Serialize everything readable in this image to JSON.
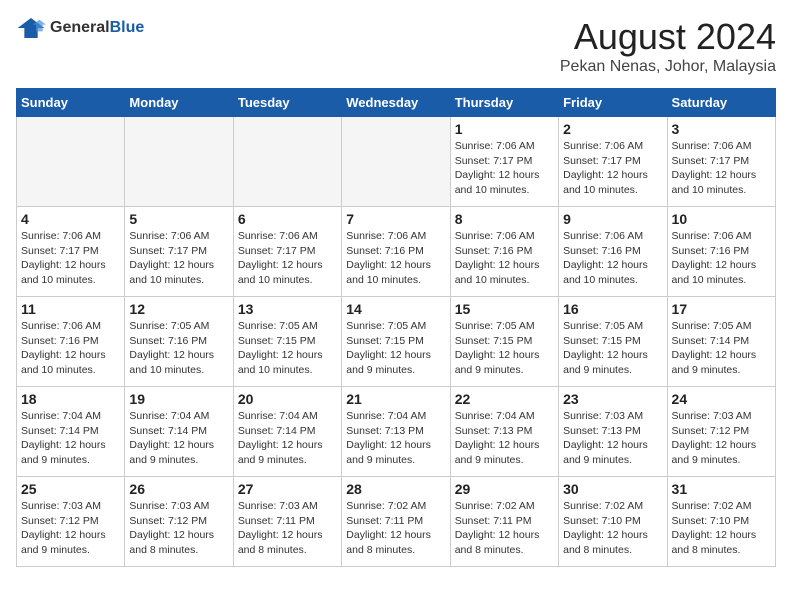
{
  "logo": {
    "general": "General",
    "blue": "Blue"
  },
  "title": "August 2024",
  "subtitle": "Pekan Nenas, Johor, Malaysia",
  "headers": [
    "Sunday",
    "Monday",
    "Tuesday",
    "Wednesday",
    "Thursday",
    "Friday",
    "Saturday"
  ],
  "weeks": [
    [
      {
        "day": "",
        "info": ""
      },
      {
        "day": "",
        "info": ""
      },
      {
        "day": "",
        "info": ""
      },
      {
        "day": "",
        "info": ""
      },
      {
        "day": "1",
        "info": "Sunrise: 7:06 AM\nSunset: 7:17 PM\nDaylight: 12 hours\nand 10 minutes."
      },
      {
        "day": "2",
        "info": "Sunrise: 7:06 AM\nSunset: 7:17 PM\nDaylight: 12 hours\nand 10 minutes."
      },
      {
        "day": "3",
        "info": "Sunrise: 7:06 AM\nSunset: 7:17 PM\nDaylight: 12 hours\nand 10 minutes."
      }
    ],
    [
      {
        "day": "4",
        "info": "Sunrise: 7:06 AM\nSunset: 7:17 PM\nDaylight: 12 hours\nand 10 minutes."
      },
      {
        "day": "5",
        "info": "Sunrise: 7:06 AM\nSunset: 7:17 PM\nDaylight: 12 hours\nand 10 minutes."
      },
      {
        "day": "6",
        "info": "Sunrise: 7:06 AM\nSunset: 7:17 PM\nDaylight: 12 hours\nand 10 minutes."
      },
      {
        "day": "7",
        "info": "Sunrise: 7:06 AM\nSunset: 7:16 PM\nDaylight: 12 hours\nand 10 minutes."
      },
      {
        "day": "8",
        "info": "Sunrise: 7:06 AM\nSunset: 7:16 PM\nDaylight: 12 hours\nand 10 minutes."
      },
      {
        "day": "9",
        "info": "Sunrise: 7:06 AM\nSunset: 7:16 PM\nDaylight: 12 hours\nand 10 minutes."
      },
      {
        "day": "10",
        "info": "Sunrise: 7:06 AM\nSunset: 7:16 PM\nDaylight: 12 hours\nand 10 minutes."
      }
    ],
    [
      {
        "day": "11",
        "info": "Sunrise: 7:06 AM\nSunset: 7:16 PM\nDaylight: 12 hours\nand 10 minutes."
      },
      {
        "day": "12",
        "info": "Sunrise: 7:05 AM\nSunset: 7:16 PM\nDaylight: 12 hours\nand 10 minutes."
      },
      {
        "day": "13",
        "info": "Sunrise: 7:05 AM\nSunset: 7:15 PM\nDaylight: 12 hours\nand 10 minutes."
      },
      {
        "day": "14",
        "info": "Sunrise: 7:05 AM\nSunset: 7:15 PM\nDaylight: 12 hours\nand 9 minutes."
      },
      {
        "day": "15",
        "info": "Sunrise: 7:05 AM\nSunset: 7:15 PM\nDaylight: 12 hours\nand 9 minutes."
      },
      {
        "day": "16",
        "info": "Sunrise: 7:05 AM\nSunset: 7:15 PM\nDaylight: 12 hours\nand 9 minutes."
      },
      {
        "day": "17",
        "info": "Sunrise: 7:05 AM\nSunset: 7:14 PM\nDaylight: 12 hours\nand 9 minutes."
      }
    ],
    [
      {
        "day": "18",
        "info": "Sunrise: 7:04 AM\nSunset: 7:14 PM\nDaylight: 12 hours\nand 9 minutes."
      },
      {
        "day": "19",
        "info": "Sunrise: 7:04 AM\nSunset: 7:14 PM\nDaylight: 12 hours\nand 9 minutes."
      },
      {
        "day": "20",
        "info": "Sunrise: 7:04 AM\nSunset: 7:14 PM\nDaylight: 12 hours\nand 9 minutes."
      },
      {
        "day": "21",
        "info": "Sunrise: 7:04 AM\nSunset: 7:13 PM\nDaylight: 12 hours\nand 9 minutes."
      },
      {
        "day": "22",
        "info": "Sunrise: 7:04 AM\nSunset: 7:13 PM\nDaylight: 12 hours\nand 9 minutes."
      },
      {
        "day": "23",
        "info": "Sunrise: 7:03 AM\nSunset: 7:13 PM\nDaylight: 12 hours\nand 9 minutes."
      },
      {
        "day": "24",
        "info": "Sunrise: 7:03 AM\nSunset: 7:12 PM\nDaylight: 12 hours\nand 9 minutes."
      }
    ],
    [
      {
        "day": "25",
        "info": "Sunrise: 7:03 AM\nSunset: 7:12 PM\nDaylight: 12 hours\nand 9 minutes."
      },
      {
        "day": "26",
        "info": "Sunrise: 7:03 AM\nSunset: 7:12 PM\nDaylight: 12 hours\nand 8 minutes."
      },
      {
        "day": "27",
        "info": "Sunrise: 7:03 AM\nSunset: 7:11 PM\nDaylight: 12 hours\nand 8 minutes."
      },
      {
        "day": "28",
        "info": "Sunrise: 7:02 AM\nSunset: 7:11 PM\nDaylight: 12 hours\nand 8 minutes."
      },
      {
        "day": "29",
        "info": "Sunrise: 7:02 AM\nSunset: 7:11 PM\nDaylight: 12 hours\nand 8 minutes."
      },
      {
        "day": "30",
        "info": "Sunrise: 7:02 AM\nSunset: 7:10 PM\nDaylight: 12 hours\nand 8 minutes."
      },
      {
        "day": "31",
        "info": "Sunrise: 7:02 AM\nSunset: 7:10 PM\nDaylight: 12 hours\nand 8 minutes."
      }
    ]
  ]
}
